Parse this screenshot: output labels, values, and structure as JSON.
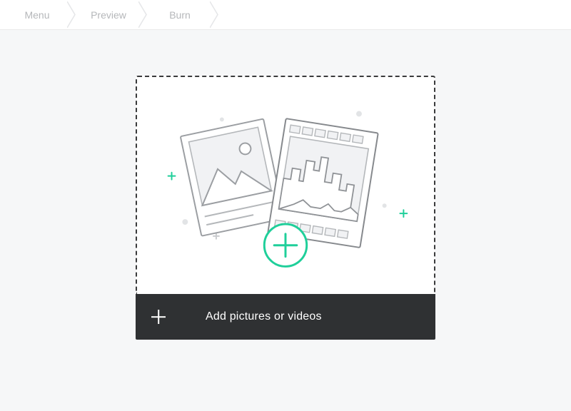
{
  "tabs": {
    "items": [
      {
        "label": "Menu"
      },
      {
        "label": "Preview"
      },
      {
        "label": "Burn"
      }
    ]
  },
  "dropzone": {
    "add_label": "Add pictures or videos"
  },
  "icons": {
    "accent": "#1fcf9a",
    "bg": "#f2f3f4"
  }
}
